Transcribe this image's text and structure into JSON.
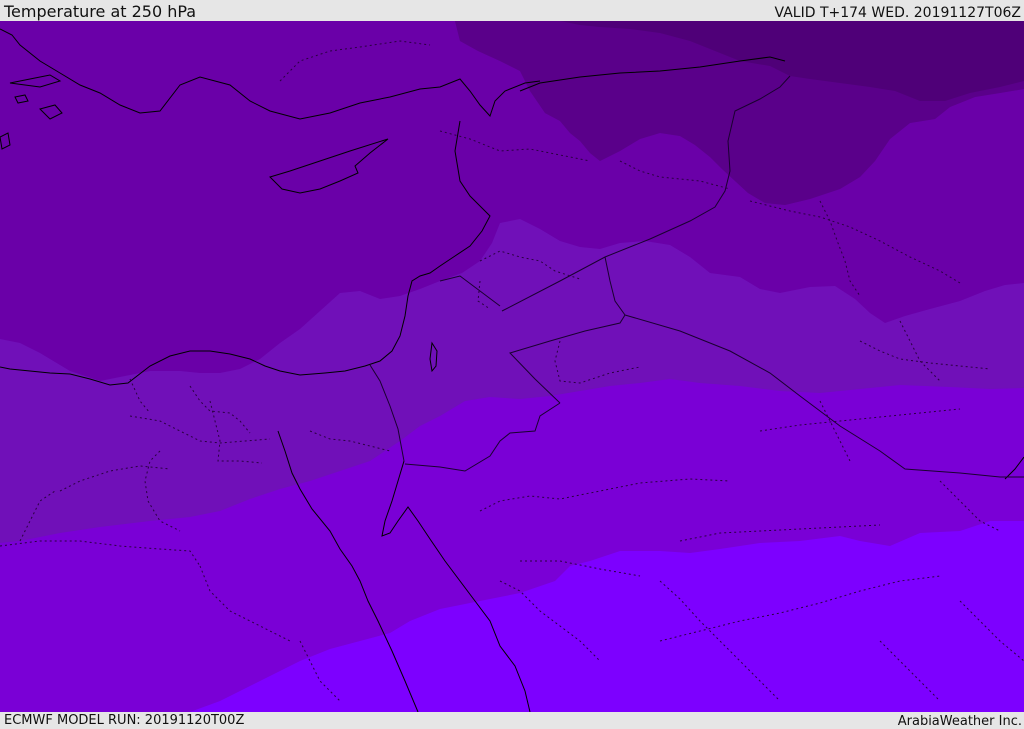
{
  "header": {
    "title": "Temperature at 250 hPa",
    "valid": "VALID T+174 WED. 20191127T06Z"
  },
  "footer": {
    "model_run": "ECMWF MODEL RUN: 20191120T00Z",
    "credit": "ArabiaWeather Inc."
  },
  "map": {
    "variable": "temperature",
    "pressure_level": "250 hPa",
    "colors": {
      "band_coldest": "#4f0078",
      "band_2": "#5a008a",
      "band_3": "#64009a",
      "band_4": "#6a00a8",
      "band_5": "#7010b8",
      "band_6": "#7a00d6",
      "band_warmest": "#7d00ff",
      "coastline": "#000000",
      "border": "#1a0030"
    }
  }
}
